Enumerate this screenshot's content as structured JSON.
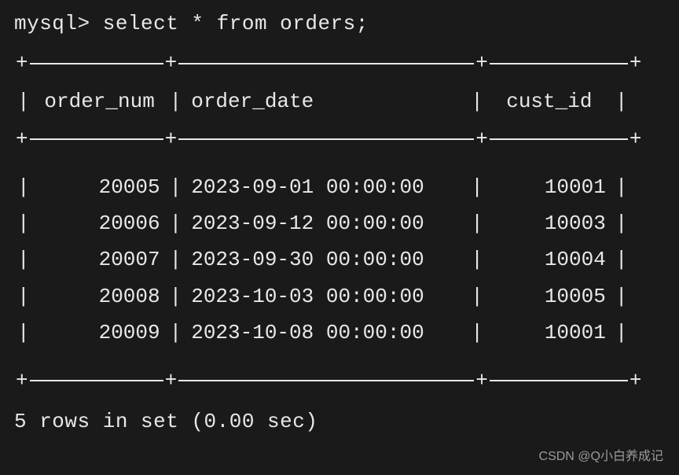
{
  "prompt": "mysql> select * from orders;",
  "columns": {
    "c1": "order_num",
    "c2": "order_date",
    "c3": "cust_id"
  },
  "rows": [
    {
      "order_num": "20005",
      "order_date": "2023-09-01 00:00:00",
      "cust_id": "10001"
    },
    {
      "order_num": "20006",
      "order_date": "2023-09-12 00:00:00",
      "cust_id": "10003"
    },
    {
      "order_num": "20007",
      "order_date": "2023-09-30 00:00:00",
      "cust_id": "10004"
    },
    {
      "order_num": "20008",
      "order_date": "2023-10-03 00:00:00",
      "cust_id": "10005"
    },
    {
      "order_num": "20009",
      "order_date": "2023-10-08 00:00:00",
      "cust_id": "10001"
    }
  ],
  "footer": "5 rows in set (0.00 sec)",
  "watermark": "CSDN @Q小白养成记"
}
